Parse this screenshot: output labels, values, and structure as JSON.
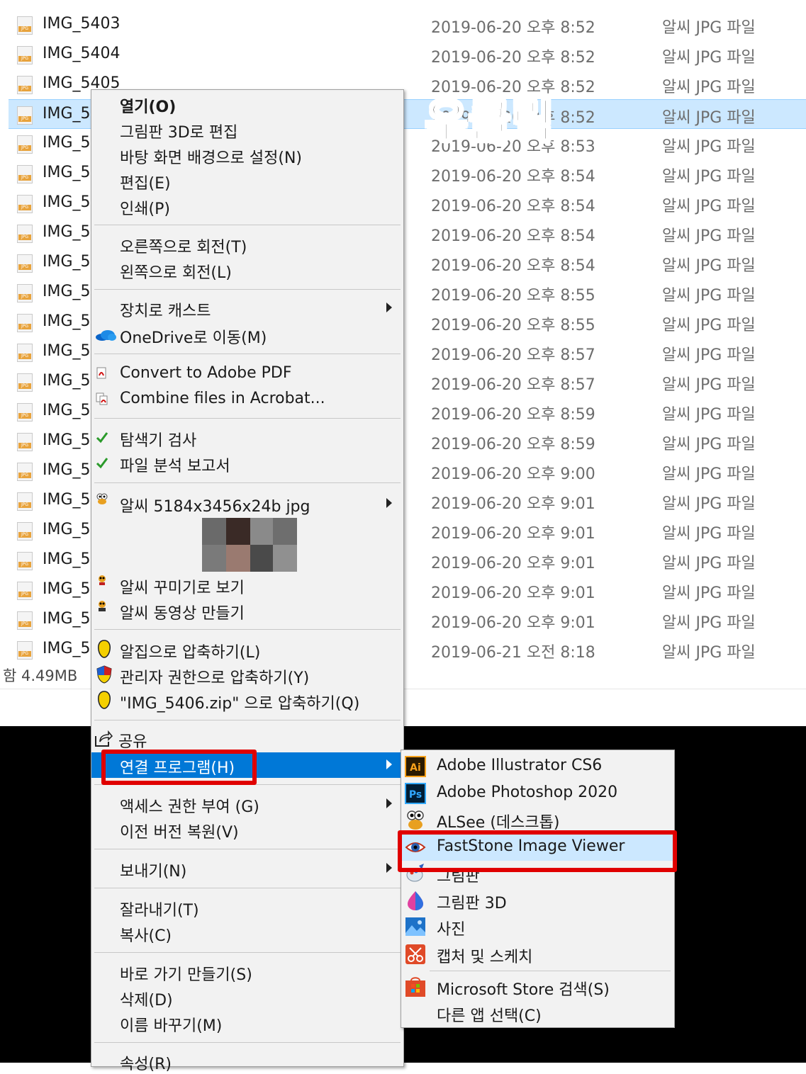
{
  "files": [
    {
      "name": "IMG_5403",
      "date": "2019-06-20 오후 8:52",
      "type": "알씨 JPG 파일"
    },
    {
      "name": "IMG_5404",
      "date": "2019-06-20 오후 8:52",
      "type": "알씨 JPG 파일"
    },
    {
      "name": "IMG_5405",
      "date": "2019-06-20 오후 8:52",
      "type": "알씨 JPG 파일"
    },
    {
      "name": "IMG_5",
      "date": "2019-06-20 오후 8:52",
      "type": "알씨 JPG 파일"
    },
    {
      "name": "IMG_5",
      "date": "2019-06-20 오후 8:53",
      "type": "알씨 JPG 파일"
    },
    {
      "name": "IMG_5",
      "date": "2019-06-20 오후 8:54",
      "type": "알씨 JPG 파일"
    },
    {
      "name": "IMG_5",
      "date": "2019-06-20 오후 8:54",
      "type": "알씨 JPG 파일"
    },
    {
      "name": "IMG_5",
      "date": "2019-06-20 오후 8:54",
      "type": "알씨 JPG 파일"
    },
    {
      "name": "IMG_5",
      "date": "2019-06-20 오후 8:54",
      "type": "알씨 JPG 파일"
    },
    {
      "name": "IMG_5",
      "date": "2019-06-20 오후 8:55",
      "type": "알씨 JPG 파일"
    },
    {
      "name": "IMG_5",
      "date": "2019-06-20 오후 8:55",
      "type": "알씨 JPG 파일"
    },
    {
      "name": "IMG_5",
      "date": "2019-06-20 오후 8:57",
      "type": "알씨 JPG 파일"
    },
    {
      "name": "IMG_5",
      "date": "2019-06-20 오후 8:57",
      "type": "알씨 JPG 파일"
    },
    {
      "name": "IMG_5",
      "date": "2019-06-20 오후 8:59",
      "type": "알씨 JPG 파일"
    },
    {
      "name": "IMG_5",
      "date": "2019-06-20 오후 8:59",
      "type": "알씨 JPG 파일"
    },
    {
      "name": "IMG_5",
      "date": "2019-06-20 오후 9:00",
      "type": "알씨 JPG 파일"
    },
    {
      "name": "IMG_5",
      "date": "2019-06-20 오후 9:01",
      "type": "알씨 JPG 파일"
    },
    {
      "name": "IMG_5",
      "date": "2019-06-20 오후 9:01",
      "type": "알씨 JPG 파일"
    },
    {
      "name": "IMG_5",
      "date": "2019-06-20 오후 9:01",
      "type": "알씨 JPG 파일"
    },
    {
      "name": "IMG_5",
      "date": "2019-06-20 오후 9:01",
      "type": "알씨 JPG 파일"
    },
    {
      "name": "IMG_5",
      "date": "2019-06-20 오후 9:01",
      "type": "알씨 JPG 파일"
    },
    {
      "name": "IMG_5",
      "date": "2019-06-21 오전 8:18",
      "type": "알씨 JPG 파일"
    }
  ],
  "selected_index": 3,
  "status": {
    "total": "함 4.49MB"
  },
  "annotation": "우클릭",
  "context_menu": {
    "open": "열기(O)",
    "paint3d_edit": "그림판 3D로 편집",
    "set_wallpaper": "바탕 화면 배경으로 설정(N)",
    "edit": "편집(E)",
    "print": "인쇄(P)",
    "rotate_right": "오른쪽으로 회전(T)",
    "rotate_left": "왼쪽으로 회전(L)",
    "cast": "장치로 캐스트",
    "onedrive": "OneDrive로 이동(M)",
    "convert_pdf": "Convert to Adobe PDF",
    "combine_acrobat": "Combine files in Acrobat...",
    "explorer_scan": "탐색기 검사",
    "file_report": "파일 분석 보고서",
    "alsee_info": "알씨 5184x3456x24b jpg",
    "alsee_decorate": "알씨 꾸미기로 보기",
    "alsee_video": "알씨 동영상 만들기",
    "alzip_compress": "알집으로 압축하기(L)",
    "admin_compress": "관리자 권한으로 압축하기(Y)",
    "zip_name_compress": "\"IMG_5406.zip\" 으로 압축하기(Q)",
    "share": "공유",
    "open_with": "연결 프로그램(H)",
    "grant_access": "액세스 권한 부여 (G)",
    "restore_versions": "이전 버전 복원(V)",
    "send_to": "보내기(N)",
    "cut": "잘라내기(T)",
    "copy": "복사(C)",
    "create_shortcut": "바로 가기 만들기(S)",
    "delete": "삭제(D)",
    "rename": "이름 바꾸기(M)",
    "properties": "속성(R)"
  },
  "open_with_submenu": {
    "illustrator": "Adobe Illustrator CS6",
    "photoshop": "Adobe Photoshop 2020",
    "alsee": "ALSee (데스크톱)",
    "faststone": "FastStone Image Viewer",
    "paint": "그림판",
    "paint3d": "그림판 3D",
    "photos": "사진",
    "snip": "캡처 및 스케치",
    "store": "Microsoft Store 검색(S)",
    "other_app": "다른 앱 선택(C)",
    "icon_text": {
      "illustrator": "Ai",
      "photoshop": "Ps"
    }
  },
  "colors": {
    "highlight": "#0078d7",
    "selection": "#cce8ff",
    "annotation_box": "#e00000"
  }
}
